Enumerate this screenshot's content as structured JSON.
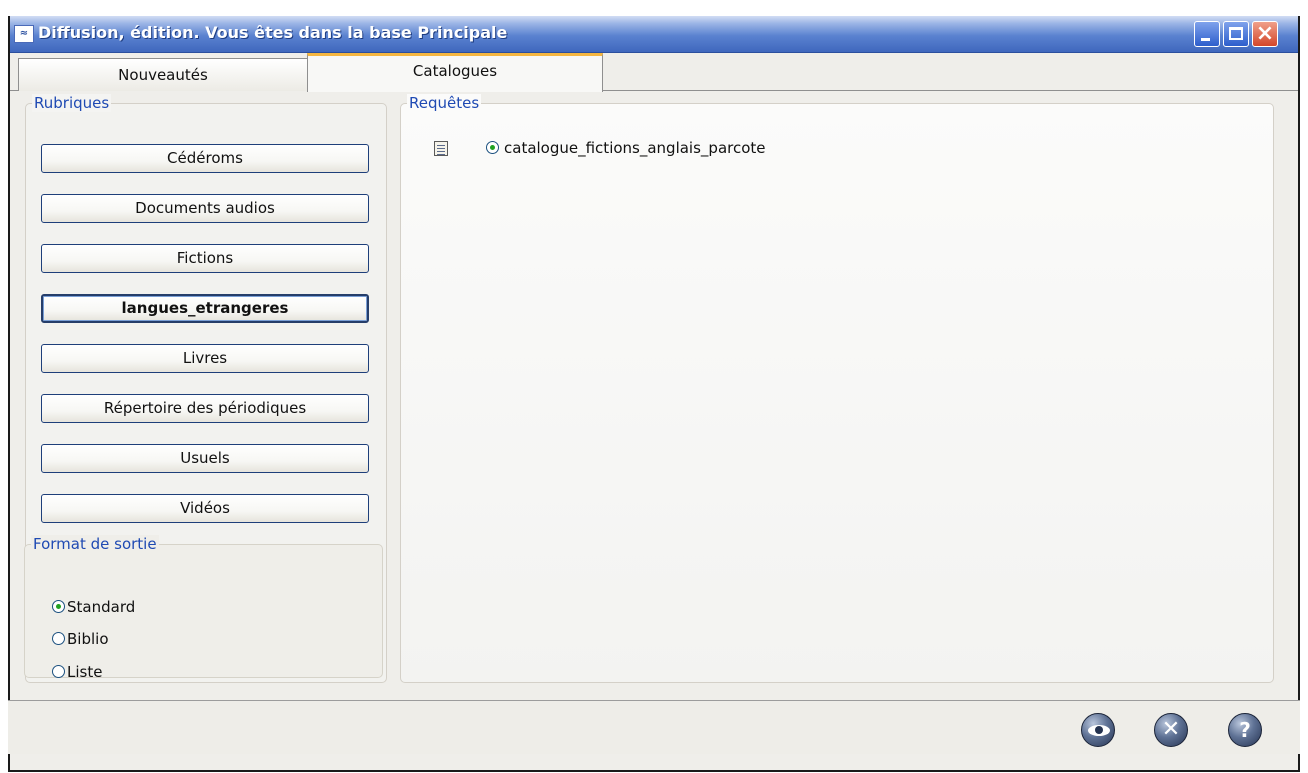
{
  "window": {
    "title": "Diffusion, édition.  Vous êtes dans la base Principale",
    "icon_name": "app-icon",
    "controls": {
      "minimize": "minimize",
      "maximize": "maximize",
      "close": "close"
    }
  },
  "tabs": [
    {
      "label": "Nouveautés",
      "active": false
    },
    {
      "label": "Catalogues",
      "active": true
    }
  ],
  "rubriques": {
    "legend": "Rubriques",
    "buttons": [
      {
        "label": "Cédéroms",
        "active": false
      },
      {
        "label": "Documents audios",
        "active": false
      },
      {
        "label": "Fictions",
        "active": false
      },
      {
        "label": "langues_etrangeres",
        "active": true
      },
      {
        "label": "Livres",
        "active": false
      },
      {
        "label": "Répertoire des périodiques",
        "active": false
      },
      {
        "label": "Usuels",
        "active": false
      },
      {
        "label": "Vidéos",
        "active": false
      }
    ]
  },
  "format": {
    "legend": "Format de sortie",
    "options": [
      {
        "label": "Standard",
        "selected": true
      },
      {
        "label": "Biblio",
        "selected": false
      },
      {
        "label": "Liste",
        "selected": false
      }
    ]
  },
  "requetes": {
    "legend": "Requêtes",
    "items": [
      {
        "label": "catalogue_fictions_anglais_parcote",
        "selected": true,
        "icon": "document-icon"
      }
    ]
  },
  "statusbar": {
    "buttons": [
      {
        "name": "preview",
        "icon": "eye-icon"
      },
      {
        "name": "cancel",
        "icon": "close-circle-icon"
      },
      {
        "name": "help",
        "icon": "help-icon"
      }
    ]
  },
  "colors": {
    "titlebar": "#3f67bd",
    "legend_text": "#1f4ab3",
    "active_tab_accent": "#f5b640",
    "radio_checked": "#21a121"
  }
}
